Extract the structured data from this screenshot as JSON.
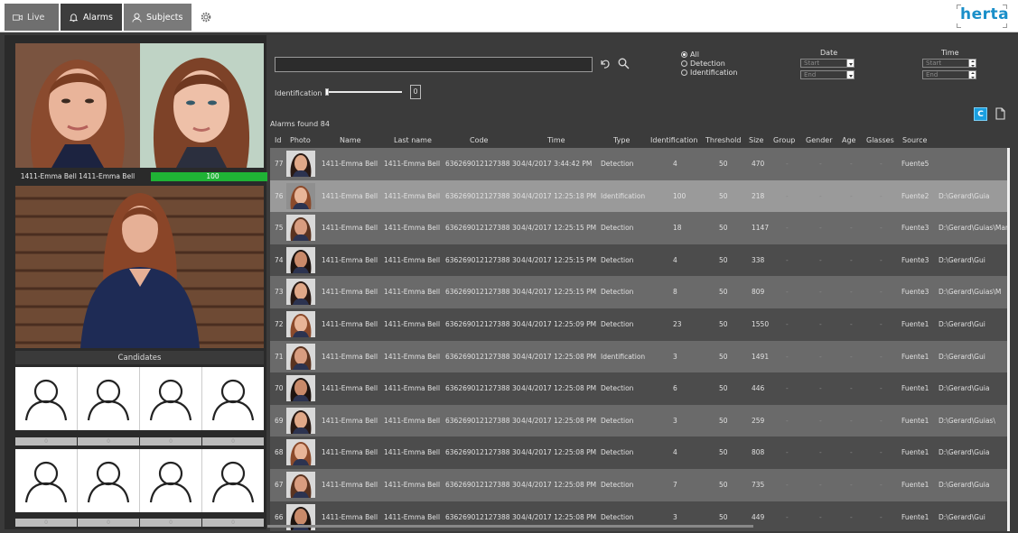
{
  "tabs": [
    {
      "label": "Live",
      "icon": "camera-icon"
    },
    {
      "label": "Alarms",
      "icon": "bell-icon"
    },
    {
      "label": "Subjects",
      "icon": "person-icon"
    }
  ],
  "brand": "herta",
  "left": {
    "match_caption": "1411-Emma Bell 1411-Emma Bell",
    "match_score": "100",
    "candidates_title": "Candidates",
    "candidate_scores_row1": [
      "0",
      "0",
      "0",
      "0"
    ],
    "candidate_scores_row2": [
      "0",
      "0",
      "0",
      "0"
    ]
  },
  "search": {
    "value": ""
  },
  "identification_label": "Identification",
  "slider": {
    "value": "0",
    "fraction": 0
  },
  "filters": {
    "all": "All",
    "detection": "Detection",
    "identification": "Identification",
    "selected": "all"
  },
  "date": {
    "label": "Date",
    "start": "Start",
    "end": "End"
  },
  "time": {
    "label": "Time",
    "start": "Start",
    "end": "End"
  },
  "alarms_found": "Alarms found 84",
  "csv_label": "C",
  "columns": [
    "Id",
    "Photo",
    "Name",
    "Last name",
    "Code",
    "Time",
    "Type",
    "Identification",
    "Threshold",
    "Size",
    "Group",
    "Gender",
    "Age",
    "Glasses",
    "Source"
  ],
  "rows": [
    {
      "id": "77",
      "name": "1411-Emma Bell",
      "last": "1411-Emma Bell",
      "code": "636269012127388 30",
      "time": "4/4/2017 3:44:42 PM",
      "type": "Detection",
      "ident": "4",
      "thr": "50",
      "size": "470",
      "group": "-",
      "gender": "-",
      "age": "-",
      "glasses": "-",
      "source": "Fuente5",
      "path": ""
    },
    {
      "id": "76",
      "name": "1411-Emma Bell",
      "last": "1411-Emma Bell",
      "code": "636269012127388 30",
      "time": "4/4/2017 12:25:18 PM",
      "type": "Identification",
      "ident": "100",
      "thr": "50",
      "size": "218",
      "group": "-",
      "gender": "-",
      "age": "-",
      "glasses": "-",
      "source": "Fuente2",
      "path": "D:\\Gerard\\Guia"
    },
    {
      "id": "75",
      "name": "1411-Emma Bell",
      "last": "1411-Emma Bell",
      "code": "636269012127388 30",
      "time": "4/4/2017 12:25:15 PM",
      "type": "Detection",
      "ident": "18",
      "thr": "50",
      "size": "1147",
      "group": "-",
      "gender": "-",
      "age": "-",
      "glasses": "-",
      "source": "Fuente3",
      "path": "D:\\Gerard\\Guias\\Man"
    },
    {
      "id": "74",
      "name": "1411-Emma Bell",
      "last": "1411-Emma Bell",
      "code": "636269012127388 30",
      "time": "4/4/2017 12:25:15 PM",
      "type": "Detection",
      "ident": "4",
      "thr": "50",
      "size": "338",
      "group": "-",
      "gender": "-",
      "age": "-",
      "glasses": "-",
      "source": "Fuente3",
      "path": "D:\\Gerard\\Gui"
    },
    {
      "id": "73",
      "name": "1411-Emma Bell",
      "last": "1411-Emma Bell",
      "code": "636269012127388 30",
      "time": "4/4/2017 12:25:15 PM",
      "type": "Detection",
      "ident": "8",
      "thr": "50",
      "size": "809",
      "group": "-",
      "gender": "-",
      "age": "-",
      "glasses": "-",
      "source": "Fuente3",
      "path": "D:\\Gerard\\Guias\\M"
    },
    {
      "id": "72",
      "name": "1411-Emma Bell",
      "last": "1411-Emma Bell",
      "code": "636269012127388 30",
      "time": "4/4/2017 12:25:09 PM",
      "type": "Detection",
      "ident": "23",
      "thr": "50",
      "size": "1550",
      "group": "-",
      "gender": "-",
      "age": "-",
      "glasses": "-",
      "source": "Fuente1",
      "path": "D:\\Gerard\\Gui"
    },
    {
      "id": "71",
      "name": "1411-Emma Bell",
      "last": "1411-Emma Bell",
      "code": "636269012127388 30",
      "time": "4/4/2017 12:25:08 PM",
      "type": "Identification",
      "ident": "3",
      "thr": "50",
      "size": "1491",
      "group": "-",
      "gender": "-",
      "age": "-",
      "glasses": "-",
      "source": "Fuente1",
      "path": "D:\\Gerard\\Gui"
    },
    {
      "id": "70",
      "name": "1411-Emma Bell",
      "last": "1411-Emma Bell",
      "code": "636269012127388 30",
      "time": "4/4/2017 12:25:08 PM",
      "type": "Detection",
      "ident": "6",
      "thr": "50",
      "size": "446",
      "group": "-",
      "gender": "-",
      "age": "-",
      "glasses": "-",
      "source": "Fuente1",
      "path": "D:\\Gerard\\Guia"
    },
    {
      "id": "69",
      "name": "1411-Emma Bell",
      "last": "1411-Emma Bell",
      "code": "636269012127388 30",
      "time": "4/4/2017 12:25:08 PM",
      "type": "Detection",
      "ident": "3",
      "thr": "50",
      "size": "259",
      "group": "-",
      "gender": "-",
      "age": "-",
      "glasses": "-",
      "source": "Fuente1",
      "path": "D:\\Gerard\\Guias\\"
    },
    {
      "id": "68",
      "name": "1411-Emma Bell",
      "last": "1411-Emma Bell",
      "code": "636269012127388 30",
      "time": "4/4/2017 12:25:08 PM",
      "type": "Detection",
      "ident": "4",
      "thr": "50",
      "size": "808",
      "group": "-",
      "gender": "-",
      "age": "-",
      "glasses": "-",
      "source": "Fuente1",
      "path": "D:\\Gerard\\Guia"
    },
    {
      "id": "67",
      "name": "1411-Emma Bell",
      "last": "1411-Emma Bell",
      "code": "636269012127388 30",
      "time": "4/4/2017 12:25:08 PM",
      "type": "Detection",
      "ident": "7",
      "thr": "50",
      "size": "735",
      "group": "-",
      "gender": "-",
      "age": "-",
      "glasses": "-",
      "source": "Fuente1",
      "path": "D:\\Gerard\\Guia"
    },
    {
      "id": "66",
      "name": "1411-Emma Bell",
      "last": "1411-Emma Bell",
      "code": "636269012127388 30",
      "time": "4/4/2017 12:25:08 PM",
      "type": "Detection",
      "ident": "3",
      "thr": "50",
      "size": "449",
      "group": "-",
      "gender": "-",
      "age": "-",
      "glasses": "-",
      "source": "Fuente1",
      "path": "D:\\Gerard\\Gui"
    }
  ]
}
